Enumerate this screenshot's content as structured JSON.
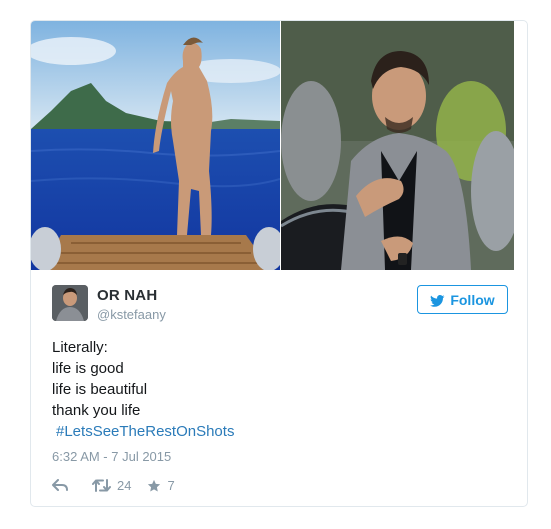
{
  "tweet": {
    "display_name": "OR NAH",
    "handle": "@kstefaany",
    "follow_label": "Follow",
    "text_lines": [
      "Literally:",
      "life is good",
      "life is beautiful",
      "thank you life"
    ],
    "hashtag": "#LetsSeeTheRestOnShots",
    "timestamp": "6:32 AM - 7 Jul 2015",
    "retweet_count": "24",
    "like_count": "7"
  },
  "icons": {
    "follow": "twitter-bird-icon",
    "reply": "reply-arrow-icon",
    "retweet": "retweet-icon",
    "like": "star-icon"
  },
  "colors": {
    "accent": "#1b95e0",
    "hashtag": "#2b7bb9",
    "name": "#292f33",
    "muted": "#8899a6",
    "border": "#e1e8ed"
  }
}
